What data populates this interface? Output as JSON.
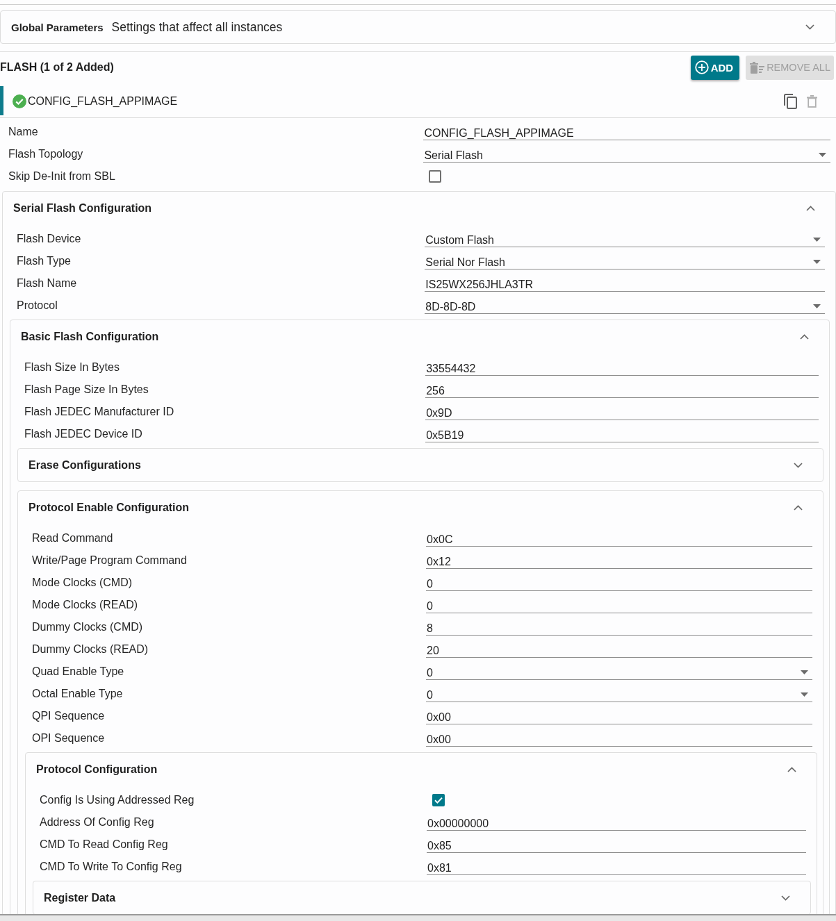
{
  "global_parameters": {
    "title": "Global Parameters",
    "description": "Settings that affect all instances",
    "expanded": false
  },
  "module": {
    "title": "FLASH (1 of 2 Added)",
    "buttons": [
      {
        "kind": "add",
        "label": "ADD",
        "disabled": false
      },
      {
        "kind": "remove_all",
        "label": "REMOVE ALL",
        "disabled": true
      }
    ]
  },
  "instance": {
    "name": "CONFIG_FLASH_APPIMAGE",
    "selected": true,
    "valid": true
  },
  "fields": [
    {
      "kind": "text",
      "label": "Name",
      "value": "CONFIG_FLASH_APPIMAGE"
    },
    {
      "kind": "select",
      "label": "Flash Topology",
      "value": "Serial Flash"
    },
    {
      "kind": "checkbox",
      "label": "Skip De-Init from SBL",
      "checked": false
    }
  ],
  "sections": [
    {
      "title": "Serial Flash Configuration",
      "expanded": true,
      "fields": [
        {
          "kind": "select",
          "label": "Flash Device",
          "value": "Custom Flash"
        },
        {
          "kind": "select",
          "label": "Flash Type",
          "value": "Serial Nor Flash"
        },
        {
          "kind": "text",
          "label": "Flash Name",
          "value": "IS25WX256JHLA3TR"
        },
        {
          "kind": "select",
          "label": "Protocol",
          "value": "8D-8D-8D"
        }
      ],
      "sections": [
        {
          "title": "Basic Flash Configuration",
          "expanded": true,
          "fields": [
            {
              "kind": "text",
              "label": "Flash Size In Bytes",
              "value": "33554432"
            },
            {
              "kind": "text",
              "label": "Flash Page Size In Bytes",
              "value": "256"
            },
            {
              "kind": "text",
              "label": "Flash JEDEC Manufacturer ID",
              "value": "0x9D"
            },
            {
              "kind": "text",
              "label": "Flash JEDEC Device ID",
              "value": "0x5B19"
            }
          ],
          "sections": [
            {
              "title": "Erase Configurations",
              "expanded": false
            },
            {
              "title": "Protocol Enable Configuration",
              "expanded": true,
              "fields": [
                {
                  "kind": "text",
                  "label": "Read Command",
                  "value": "0x0C"
                },
                {
                  "kind": "text",
                  "label": "Write/Page Program Command",
                  "value": "0x12"
                },
                {
                  "kind": "text",
                  "label": "Mode Clocks (CMD)",
                  "value": "0"
                },
                {
                  "kind": "text",
                  "label": "Mode Clocks (READ)",
                  "value": "0"
                },
                {
                  "kind": "text",
                  "label": "Dummy Clocks (CMD)",
                  "value": "8"
                },
                {
                  "kind": "text",
                  "label": "Dummy Clocks (READ)",
                  "value": "20"
                },
                {
                  "kind": "select",
                  "label": "Quad Enable Type",
                  "value": "0"
                },
                {
                  "kind": "select",
                  "label": "Octal Enable Type",
                  "value": "0"
                },
                {
                  "kind": "text",
                  "label": "QPI Sequence",
                  "value": "0x00"
                },
                {
                  "kind": "text",
                  "label": "OPI Sequence",
                  "value": "0x00"
                }
              ],
              "sections": [
                {
                  "title": "Protocol Configuration",
                  "expanded": true,
                  "fields": [
                    {
                      "kind": "checkbox",
                      "label": "Config Is Using Addressed Reg",
                      "checked": true
                    },
                    {
                      "kind": "text",
                      "label": "Address Of Config Reg",
                      "value": "0x00000000"
                    },
                    {
                      "kind": "text",
                      "label": "CMD To Read Config Reg",
                      "value": "0x85"
                    },
                    {
                      "kind": "text",
                      "label": "CMD To Write To Config Reg",
                      "value": "0x81"
                    }
                  ],
                  "sections": [
                    {
                      "title": "Register Data",
                      "expanded": false
                    }
                  ]
                }
              ]
            }
          ]
        }
      ]
    }
  ]
}
